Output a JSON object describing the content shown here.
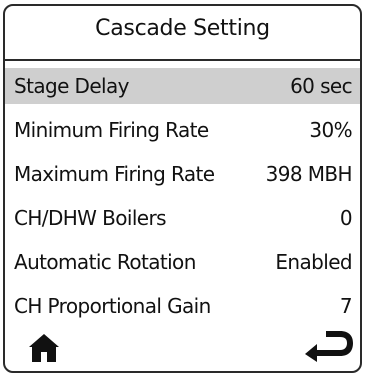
{
  "screen": {
    "title": "Cascade Setting"
  },
  "settings": [
    {
      "label": "Stage Delay",
      "value": "60 sec",
      "selected": true
    },
    {
      "label": "Minimum Firing Rate",
      "value": "30%",
      "selected": false
    },
    {
      "label": "Maximum Firing Rate",
      "value": "398 MBH",
      "selected": false
    },
    {
      "label": "CH/DHW Boilers",
      "value": "0",
      "selected": false
    },
    {
      "label": "Automatic Rotation",
      "value": "Enabled",
      "selected": false
    },
    {
      "label": "CH Proportional Gain",
      "value": "7",
      "selected": false
    }
  ],
  "footer": {
    "home_icon": "home-icon",
    "back_icon": "return-arrow-icon"
  },
  "colors": {
    "selected_row": "#cfcfcf",
    "frame": "#2a2a2a",
    "text": "#111111"
  }
}
